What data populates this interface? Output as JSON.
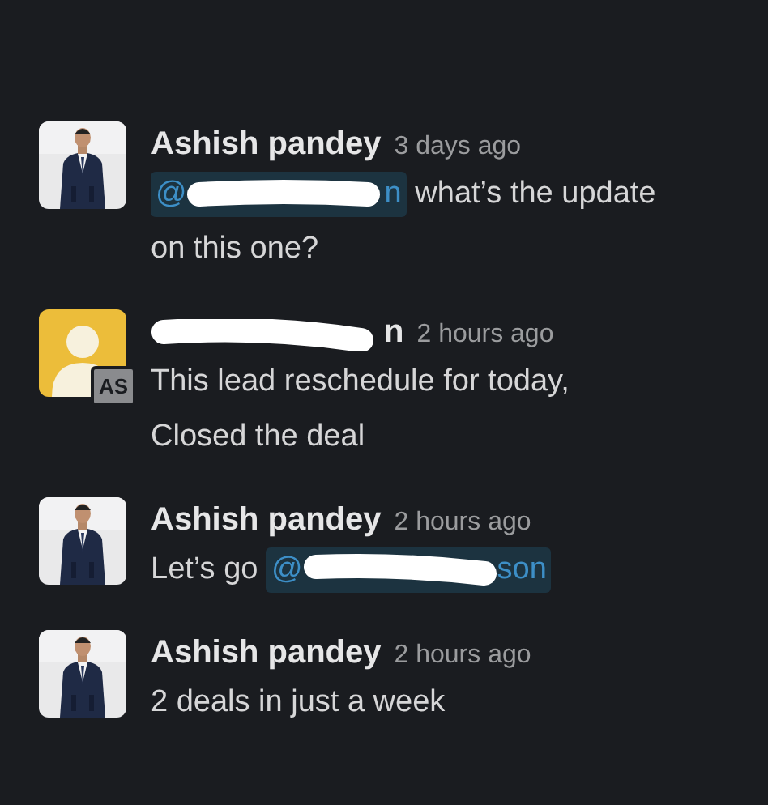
{
  "messages": [
    {
      "author": {
        "name": "Ashish pandey"
      },
      "avatar": {
        "kind": "picture"
      },
      "time": "3 days ago",
      "body": [
        {
          "kind": "mention",
          "start": "@",
          "end": "n",
          "redacted": true
        },
        {
          "kind": "text",
          "text": " what’s the update on this one?"
        }
      ]
    },
    {
      "author": {
        "name": "n",
        "redacted": true
      },
      "avatar": {
        "kind": "default",
        "badge": "AS"
      },
      "time": "2 hours ago",
      "body": [
        {
          "kind": "text",
          "text": "This lead reschedule for today,\nClosed the deal"
        }
      ]
    },
    {
      "author": {
        "name": "Ashish pandey"
      },
      "avatar": {
        "kind": "picture"
      },
      "time": "2 hours ago",
      "body": [
        {
          "kind": "text",
          "text": "Let’s go "
        },
        {
          "kind": "mention",
          "start": "@",
          "end": "son",
          "redacted": true
        }
      ]
    },
    {
      "author": {
        "name": "Ashish pandey"
      },
      "avatar": {
        "kind": "picture"
      },
      "time": "2 hours ago",
      "body": [
        {
          "kind": "text",
          "text": "2 deals in just a week"
        }
      ]
    }
  ]
}
